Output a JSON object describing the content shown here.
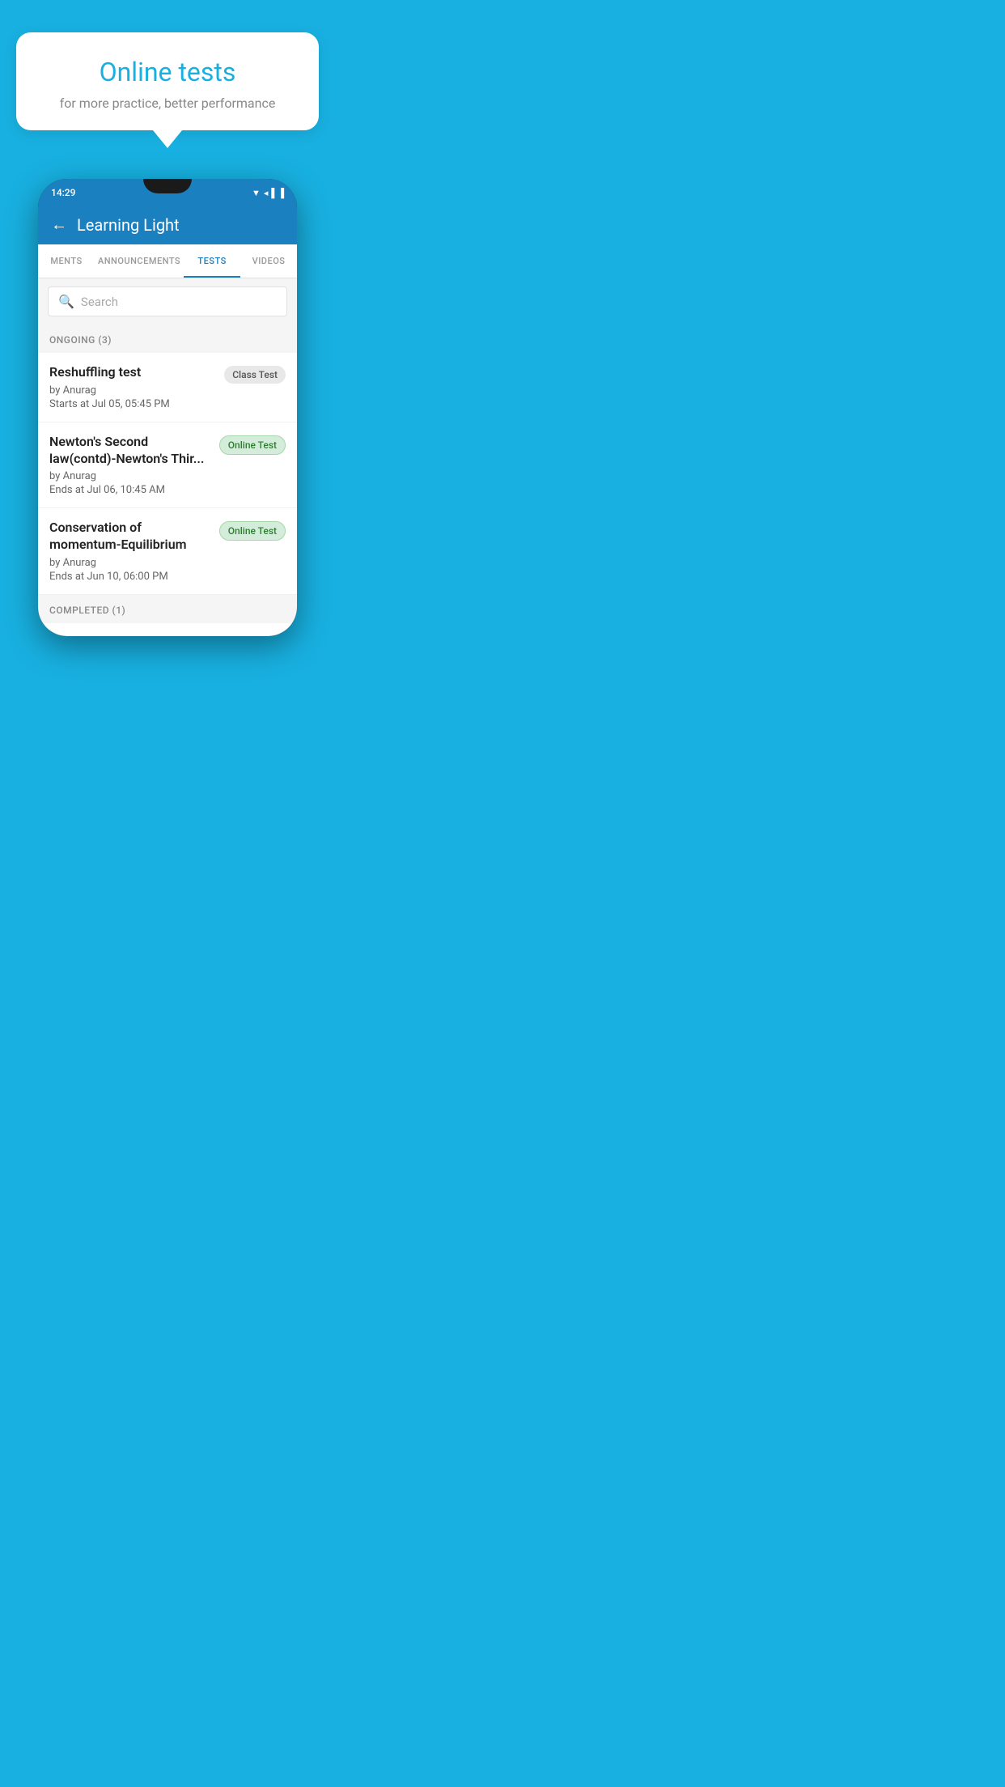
{
  "background_color": "#18b0e0",
  "bubble": {
    "title": "Online tests",
    "subtitle": "for more practice, better performance"
  },
  "phone": {
    "status_bar": {
      "time": "14:29",
      "icons": "▼ ◂ ▐"
    },
    "header": {
      "title": "Learning Light",
      "back_label": "←"
    },
    "tabs": [
      {
        "label": "MENTS",
        "active": false
      },
      {
        "label": "ANNOUNCEMENTS",
        "active": false
      },
      {
        "label": "TESTS",
        "active": true
      },
      {
        "label": "VIDEOS",
        "active": false
      }
    ],
    "search": {
      "placeholder": "Search"
    },
    "sections": [
      {
        "label": "ONGOING (3)",
        "tests": [
          {
            "name": "Reshuffling test",
            "by": "by Anurag",
            "date": "Starts at  Jul 05, 05:45 PM",
            "badge": "Class Test",
            "badge_type": "class"
          },
          {
            "name": "Newton's Second law(contd)-Newton's Thir...",
            "by": "by Anurag",
            "date": "Ends at  Jul 06, 10:45 AM",
            "badge": "Online Test",
            "badge_type": "online"
          },
          {
            "name": "Conservation of momentum-Equilibrium",
            "by": "by Anurag",
            "date": "Ends at  Jun 10, 06:00 PM",
            "badge": "Online Test",
            "badge_type": "online"
          }
        ]
      }
    ],
    "completed_label": "COMPLETED (1)"
  }
}
